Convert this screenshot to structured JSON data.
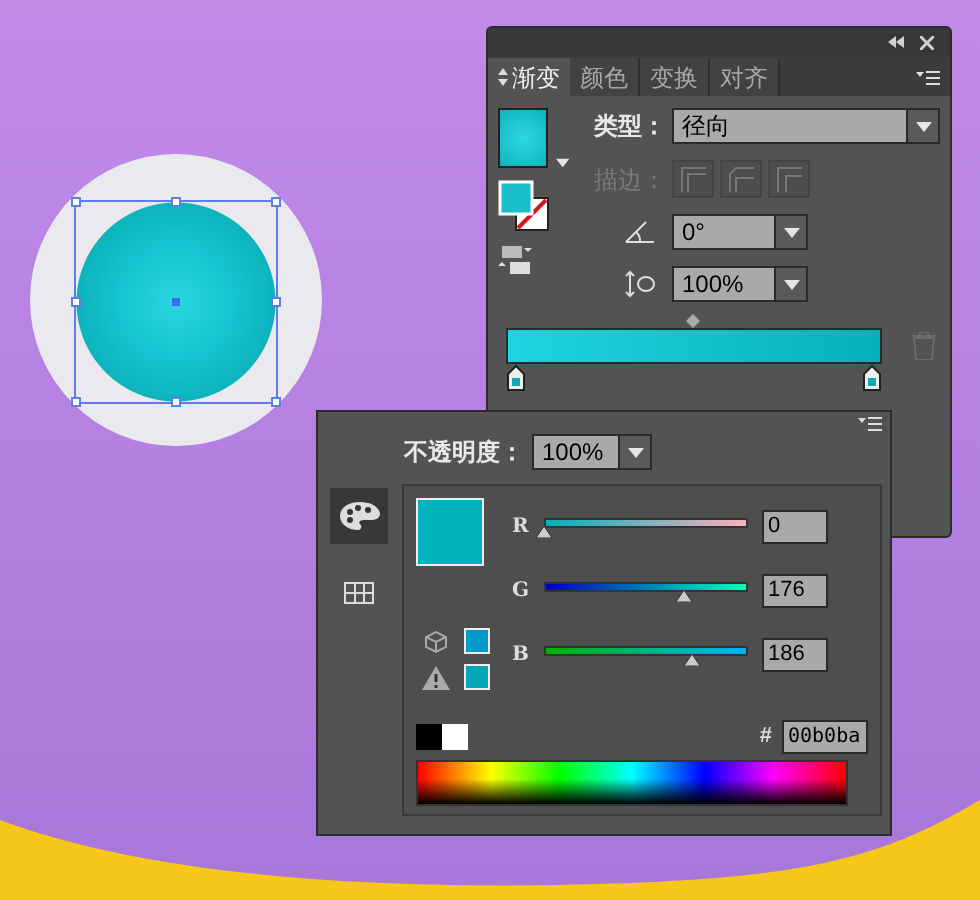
{
  "gradient_panel": {
    "tabs": [
      {
        "label": "渐变",
        "selected": true
      },
      {
        "label": "颜色",
        "selected": false
      },
      {
        "label": "变换",
        "selected": false
      },
      {
        "label": "对齐",
        "selected": false
      }
    ],
    "type": {
      "label": "类型：",
      "value": "径向"
    },
    "stroke": {
      "label": "描边：",
      "disabled": true
    },
    "angle": {
      "value": "0°"
    },
    "aspect_ratio": {
      "value": "100%"
    },
    "stops": [
      {
        "level": 0
      },
      {
        "level": 1
      }
    ]
  },
  "color_panel": {
    "opacity": {
      "label": "不透明度：",
      "value": "100%"
    },
    "modes": [
      {
        "kind": "palette",
        "selected": true
      },
      {
        "kind": "grid",
        "selected": false
      }
    ],
    "channels": [
      {
        "name": "R",
        "level": 0,
        "value": "0"
      },
      {
        "name": "G",
        "level": 0.69,
        "value": "176"
      },
      {
        "name": "B",
        "level": 0.73,
        "value": "186"
      }
    ],
    "hex": {
      "label": "#",
      "value": "00b0ba"
    }
  }
}
